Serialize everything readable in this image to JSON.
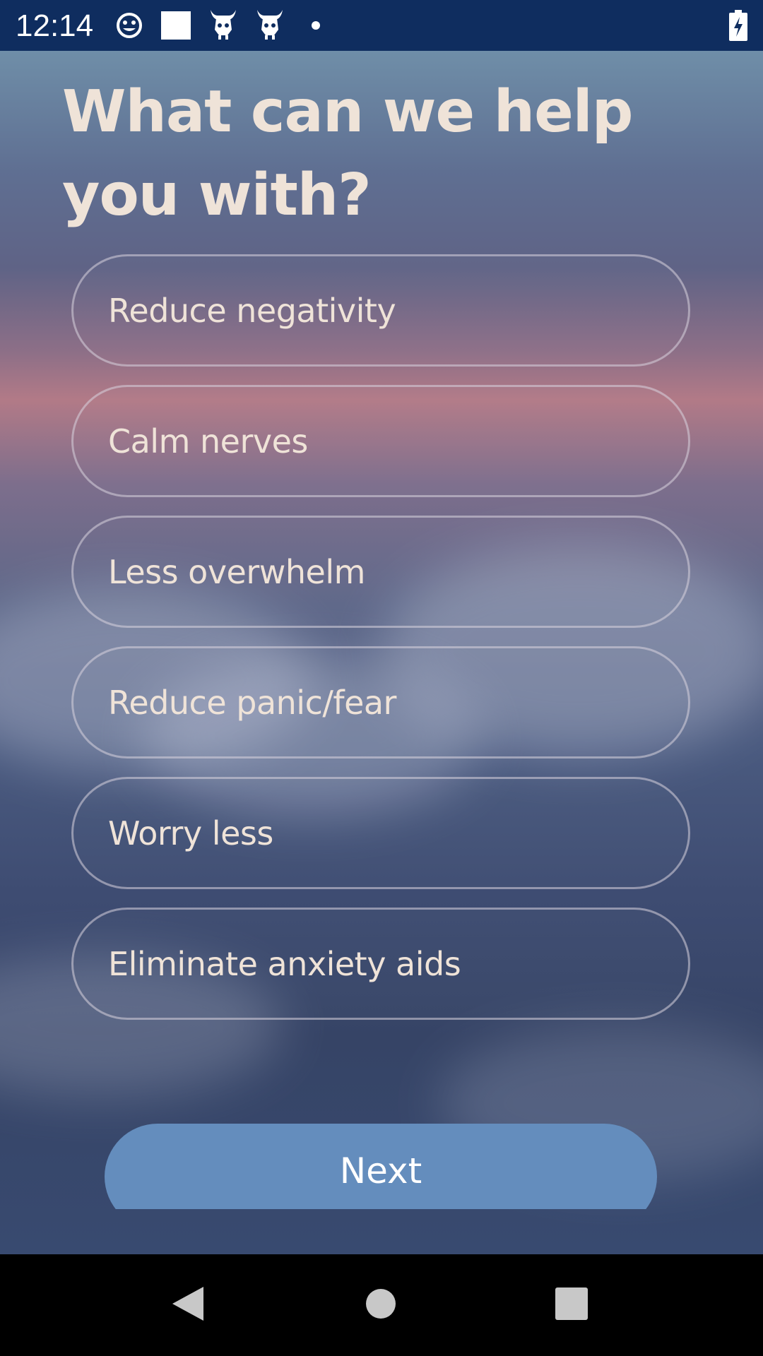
{
  "status_bar": {
    "time": "12:14",
    "icons": [
      "emoji-notification-icon",
      "white-square-icon",
      "demon-icon",
      "demon-icon",
      "dot-icon"
    ],
    "battery_icon": "battery-charging-icon"
  },
  "onboarding": {
    "title": "What can we help you with?",
    "options": [
      {
        "label": "Reduce negativity"
      },
      {
        "label": "Calm nerves"
      },
      {
        "label": "Less overwhelm"
      },
      {
        "label": "Reduce panic/fear"
      },
      {
        "label": "Worry less"
      },
      {
        "label": "Eliminate anxiety aids"
      }
    ],
    "next_label": "Next"
  },
  "nav_bar": {
    "back_icon": "back-triangle-icon",
    "home_icon": "home-circle-icon",
    "recents_icon": "recents-square-icon"
  },
  "colors": {
    "status_bar_bg": "#0f2d5f",
    "title_text": "#efe3d8",
    "option_border": "#d7d2dc",
    "next_button_bg": "#648dbd"
  }
}
